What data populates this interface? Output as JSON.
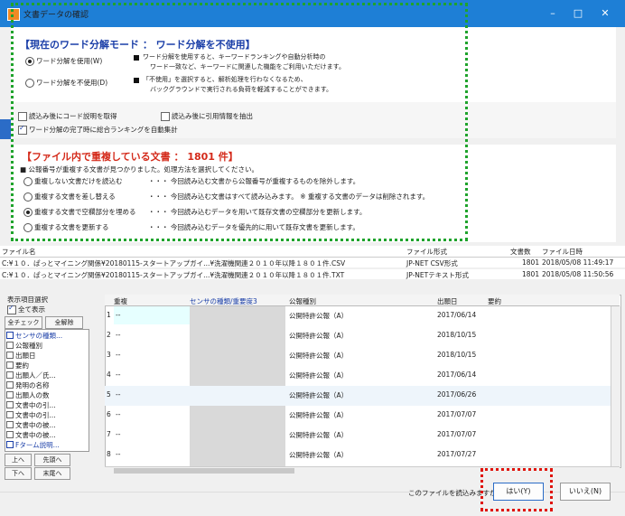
{
  "window": {
    "title": "文書データの確認",
    "controls": {
      "minimize": "–",
      "maximize": "□",
      "close": "✕"
    }
  },
  "mode": {
    "title": "【現在のワード分解モード ： ワード分解を不使用】",
    "options": [
      {
        "label": "ワード分解を使用(W)",
        "selected": true,
        "note": [
          "ワード分解を使用すると、キーワードランキングや自動分析時の",
          "ワード一致など、キーワードに関連した機能をご利用いただけます。"
        ]
      },
      {
        "label": "ワード分解を不使用(D)",
        "selected": false,
        "note": [
          "「不使用」を選択すると、解析処理を行わなくなるため、",
          "バックグラウンドで実行される負荷を軽減することができます。"
        ]
      }
    ]
  },
  "load_options": [
    {
      "label": "読込み後にコード説明を取得",
      "checked": false
    },
    {
      "label": "読込み後に引用情報を抽出",
      "checked": false
    },
    {
      "label": "ワード分解の完了時に総合ランキングを自動集計",
      "checked": true
    }
  ],
  "duplicates": {
    "title": "【ファイル内で重複している文書 ： 1801 件】",
    "intro": "■ 公報番号が重複する文書が見つかりました。処理方法を選択してください。",
    "options": [
      {
        "label": "重複しない文書だけを読込む",
        "desc": "・・・ 今回読み込む文書から公報番号が重複するものを除外します。",
        "selected": false
      },
      {
        "label": "重複する文書を差し替える",
        "desc": "・・・ 今回読み込む文書はすべて読み込みます。 ※ 重複する文書のデータは削除されます。",
        "selected": false
      },
      {
        "label": "重複する文書で空欄部分を埋める",
        "desc": "・・・ 今回読み込むデータを用いて既存文書の空欄部分を更新します。",
        "selected": true
      },
      {
        "label": "重複する文書を更新する",
        "desc": "・・・ 今回読み込むデータを優先的に用いて既存文書を更新します。",
        "selected": false
      }
    ]
  },
  "files": {
    "headers": {
      "name": "ファイル名",
      "format": "ファイル形式",
      "count": "文書数",
      "datetime": "ファイル日時"
    },
    "rows": [
      {
        "name": "C:¥１０．ぱっとマイニング関係¥20180115-スタートアップガイ...¥洗濯機関連２０１０年以降１８０１件.CSV",
        "format": "JP-NET CSV形式",
        "count": "1801",
        "datetime": "2018/05/08 11:49:17"
      },
      {
        "name": "C:¥１０．ぱっとマイニング関係¥20180115-スタートアップガイ...¥洗濯機関連２０１０年以降１８０１件.TXT",
        "format": "JP-NETテキスト形式",
        "count": "1801",
        "datetime": "2018/05/08 11:50:56"
      }
    ]
  },
  "display_items": {
    "title": "表示項目選択",
    "show_all": "全て表示",
    "check_all": "全チェック",
    "clear_all": "全解除",
    "items": [
      "センサの種類...",
      "公報種別",
      "出願日",
      "要約",
      "出願人／氏...",
      "発明の名称",
      "出願人の数",
      "文書中の引...",
      "文書中の引...",
      "文書中の被...",
      "文書中の被...",
      "Fターム説明..."
    ],
    "buttons": {
      "up": "上へ",
      "top": "先頭へ",
      "down": "下へ",
      "bottom": "末尾へ"
    }
  },
  "grid": {
    "columns": [
      "重複",
      "センサの種類/重要度3",
      "公報種別",
      "出願日",
      "要約"
    ],
    "rows": [
      {
        "num": "1",
        "dup": "--",
        "type": "公開特許公報（A）",
        "date": "2017/06/14"
      },
      {
        "num": "2",
        "dup": "--",
        "type": "公開特許公報（A）",
        "date": "2018/10/15"
      },
      {
        "num": "3",
        "dup": "--",
        "type": "公開特許公報（A）",
        "date": "2018/10/15"
      },
      {
        "num": "4",
        "dup": "--",
        "type": "公開特許公報（A）",
        "date": "2017/06/14"
      },
      {
        "num": "5",
        "dup": "--",
        "type": "公開特許公報（A）",
        "date": "2017/06/26"
      },
      {
        "num": "6",
        "dup": "--",
        "type": "公開特許公報（A）",
        "date": "2017/07/07"
      },
      {
        "num": "7",
        "dup": "--",
        "type": "公開特許公報（A）",
        "date": "2017/07/07"
      },
      {
        "num": "8",
        "dup": "--",
        "type": "公開特許公報（A）",
        "date": "2017/07/27"
      }
    ]
  },
  "footer": {
    "question": "このファイルを読込みますか？",
    "yes": "はい(Y)",
    "no": "いいえ(N)"
  },
  "colors": {
    "titlebar": "#1e7fd6",
    "green_highlight": "#1fa32c",
    "red_highlight": "#e0140c",
    "mode_title": "#1b3fa8",
    "dup_title": "#d42a1a"
  }
}
